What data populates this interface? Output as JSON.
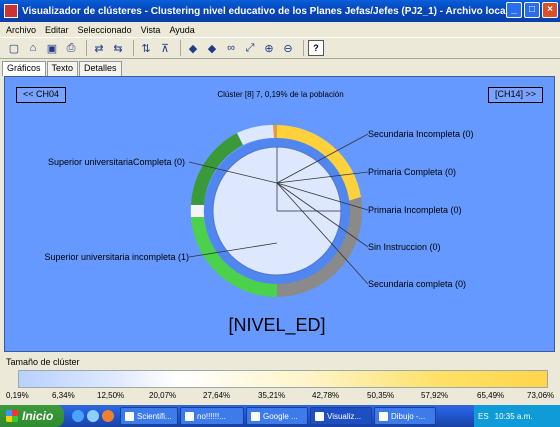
{
  "window": {
    "title": "Visualizador de clústeres - Clustering nivel educativo de los Planes Jefas/Jefes (PJ2_1) - Archivo local: general l...",
    "minimize": "_",
    "maximize": "□",
    "close": "×"
  },
  "menu": [
    "Archivo",
    "Editar",
    "Seleccionado",
    "Vista",
    "Ayuda"
  ],
  "toolbar": {
    "icons": [
      "new-icon",
      "open-icon",
      "save-icon",
      "print-icon",
      "undo-icon",
      "redo-icon",
      "sort-icon",
      "filter-icon",
      "back-icon",
      "forward-icon",
      "find-icon",
      "select-icon",
      "zoom-in-icon",
      "zoom-out-icon",
      "help-icon"
    ],
    "help_label": "?"
  },
  "tabs": [
    "Gráficos",
    "Texto",
    "Detalles"
  ],
  "panel": {
    "prev_label": "<< CH04",
    "next_label": "[CH14] >>",
    "cluster_info": "Clúster [8] 7, 0,19% de la población",
    "center_label": "[NIVEL_ED]"
  },
  "chart_data": {
    "type": "pie",
    "title": "[NIVEL_ED]",
    "segments": [
      {
        "name": "Secundaria Incompleta (0)",
        "color": "#ffcc33"
      },
      {
        "name": "Primaria Completa (0)",
        "color": "#ffcc33"
      },
      {
        "name": "Primaria Incompleta (0)",
        "color": "#888888"
      },
      {
        "name": "Sin Instruccion (0)",
        "color": "#888888"
      },
      {
        "name": "Secundaria completa (0)",
        "color": "#888888"
      },
      {
        "name": "Superior universitaria incompleta (1)",
        "color": "#44cc44"
      },
      {
        "name": "Superior universitariaCompleta (0)",
        "color": "#339933"
      }
    ]
  },
  "size_legend": {
    "title": "Tamaño de clúster",
    "ticks": [
      "0,19%",
      "6,34%",
      "12,50%",
      "20,07%",
      "27,64%",
      "35,21%",
      "42,78%",
      "50,35%",
      "57,92%",
      "65,49%",
      "73,06%"
    ]
  },
  "taskbar": {
    "start_label": "Inicio",
    "tasks": [
      "Scientifi...",
      "no!!!!!!...",
      "Google ...",
      "Visualiz...",
      "Dibujo -..."
    ],
    "lang": "ES",
    "clock": "10:35 a.m."
  }
}
